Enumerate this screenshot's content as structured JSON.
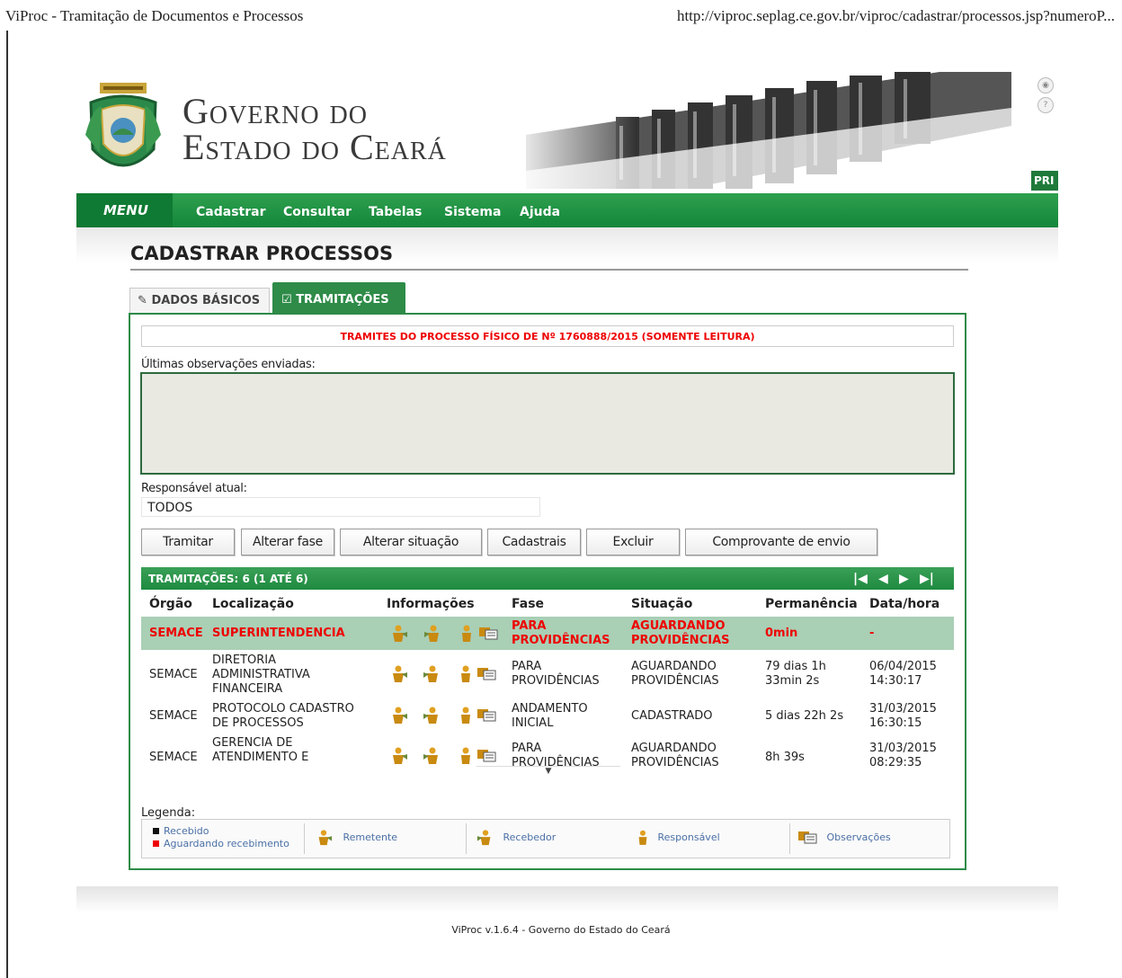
{
  "browser": {
    "title": "ViProc - Tramitação de Documentos e Processos",
    "url": "http://viproc.seplag.ce.gov.br/viproc/cadastrar/processos.jsp?numeroP..."
  },
  "header": {
    "line1": "Governo do",
    "line2": "Estado do Ceará",
    "pri": "PRI"
  },
  "menu": {
    "label": "MENU",
    "items": [
      "Cadastrar",
      "Consultar",
      "Tabelas",
      "Sistema",
      "Ajuda"
    ]
  },
  "page": {
    "title": "CADASTRAR PROCESSOS"
  },
  "tabs": [
    {
      "label": "DADOS BÁSICOS"
    },
    {
      "label": "TRAMITAÇÕES"
    }
  ],
  "notice": "TRAMITES DO PROCESSO FÍSICO DE Nº 1760888/2015 (SOMENTE LEITURA)",
  "obs_label": "Últimas observações enviadas:",
  "resp_label": "Responsável atual:",
  "resp_value": "TODOS",
  "buttons": [
    "Tramitar",
    "Alterar fase",
    "Alterar situação",
    "Cadastrais",
    "Excluir",
    "Comprovante de envio"
  ],
  "table": {
    "count": "TRAMITAÇÕES: 6 (1 ATÉ 6)",
    "columns": [
      "Órgão",
      "Localização",
      "Informações",
      "Fase",
      "Situação",
      "Permanência",
      "Data/hora"
    ],
    "rows": [
      {
        "orgao": "SEMACE",
        "local": "SUPERINTENDENCIA",
        "fase": "PARA PROVIDÊNCIAS",
        "situacao": "AGUARDANDO PROVIDÊNCIAS",
        "perm": "0min",
        "data": "-"
      },
      {
        "orgao": "SEMACE",
        "local": "DIRETORIA ADMINISTRATIVA FINANCEIRA",
        "fase": "PARA PROVIDÊNCIAS",
        "situacao": "AGUARDANDO PROVIDÊNCIAS",
        "perm": "79 dias 1h 33min 2s",
        "data": "06/04/2015 14:30:17"
      },
      {
        "orgao": "SEMACE",
        "local": "PROTOCOLO CADASTRO DE PROCESSOS",
        "fase": "ANDAMENTO INICIAL",
        "situacao": "CADASTRADO",
        "perm": "5 dias 22h 2s",
        "data": "31/03/2015 16:30:15"
      },
      {
        "orgao": "SEMACE",
        "local": "GERENCIA DE ATENDIMENTO E",
        "fase": "PARA PROVIDÊNCIAS",
        "situacao": "AGUARDANDO PROVIDÊNCIAS",
        "perm": "8h 39s",
        "data": "31/03/2015 08:29:35"
      }
    ]
  },
  "legend": {
    "title": "Legenda:",
    "recebido": "Recebido",
    "aguardando": "Aguardando recebimento",
    "remetente": "Remetente",
    "recebedor": "Recebedor",
    "responsavel": "Responsável",
    "observacoes": "Observações"
  },
  "footer": "ViProc v.1.6.4 - Governo do Estado do Ceará",
  "colors": {
    "green": "#2e8b48",
    "red": "#e00000",
    "highlight": "#a9cfb5"
  }
}
